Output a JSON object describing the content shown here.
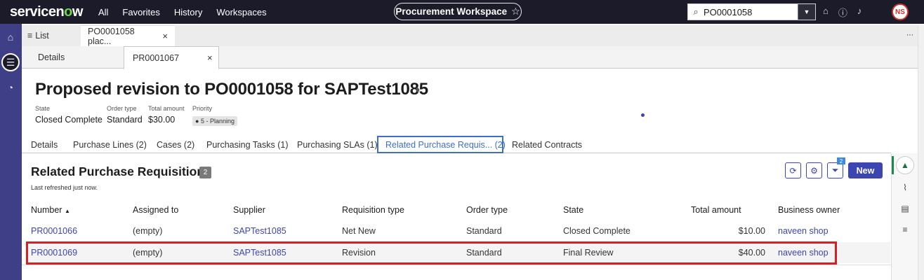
{
  "topnav": {
    "logo": "servicenow",
    "items": [
      "All",
      "Favorites",
      "History",
      "Workspaces"
    ],
    "workspace_title": "Procurement Workspace",
    "search_value": "PO0001058",
    "avatar_initials": "NS"
  },
  "tabs_primary": [
    {
      "label": "List"
    },
    {
      "label": "PO0001058 plac..."
    }
  ],
  "tabs_secondary": [
    {
      "label": "Details"
    },
    {
      "label": "PR0001067"
    }
  ],
  "record": {
    "title": "Proposed revision to PO0001058 for SAPTest1085",
    "fields": [
      {
        "label": "State",
        "value": "Closed Complete"
      },
      {
        "label": "Order type",
        "value": "Standard"
      },
      {
        "label": "Total amount",
        "value": "$30.00"
      },
      {
        "label": "Priority",
        "value": "5 - Planning"
      }
    ]
  },
  "related_tabs": [
    "Details",
    "Purchase Lines (2)",
    "Cases (2)",
    "Purchasing Tasks (1)",
    "Purchasing SLAs (1)",
    "Related Purchase Requis... (2)",
    "Related Contracts"
  ],
  "list": {
    "title": "Related Purchase Requisitions",
    "count": "2",
    "refreshed": "Last refreshed just now.",
    "filter_count": "2",
    "new_label": "New",
    "columns": [
      "Number",
      "Assigned to",
      "Supplier",
      "Requisition type",
      "Order type",
      "State",
      "Total amount",
      "Business owner"
    ],
    "rows": [
      [
        "PR0001066",
        "(empty)",
        "SAPTest1085",
        "Net New",
        "Standard",
        "Closed Complete",
        "$10.00",
        "naveen shop"
      ],
      [
        "PR0001069",
        "(empty)",
        "SAPTest1085",
        "Revision",
        "Standard",
        "Final Review",
        "$40.00",
        "naveen shop"
      ]
    ]
  },
  "colors": {
    "topbar": "#1c1b29",
    "rail": "#3f3f88",
    "primary": "#3d45b0",
    "highlight": "#d81f26"
  }
}
